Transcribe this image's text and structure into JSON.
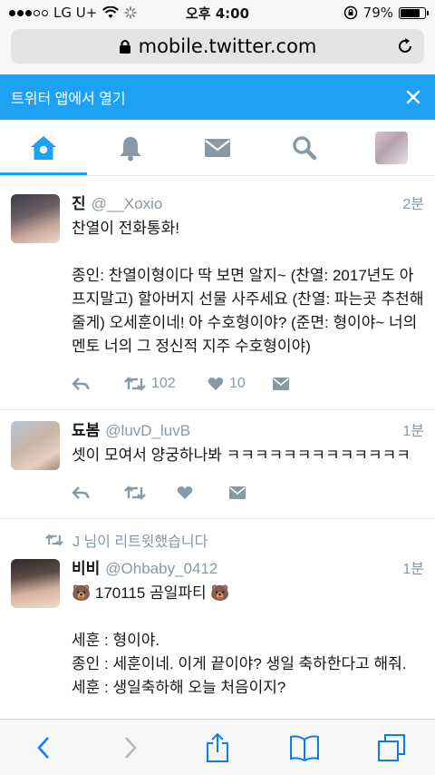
{
  "status_bar": {
    "carrier": "LG U+",
    "time": "오후 4:00",
    "battery_percent": "79%",
    "battery_level": 0.79,
    "signal_bars_filled": 3
  },
  "browser": {
    "url": "mobile.twitter.com"
  },
  "banner": {
    "text": "트위터 앱에서 열기"
  },
  "nav": {
    "items": [
      {
        "icon": "home-icon",
        "active": true
      },
      {
        "icon": "notifications-bell-icon",
        "active": false
      },
      {
        "icon": "messages-envelope-icon",
        "active": false
      },
      {
        "icon": "search-icon",
        "active": false
      },
      {
        "icon": "profile-avatar",
        "active": false
      }
    ]
  },
  "timeline": {
    "tweets": [
      {
        "name": "진",
        "handle": "@__Xoxio",
        "time": "2분",
        "text": "찬열이 전화통화!\n\n종인: 찬열이형이다 딱 보면 알지~ (찬열: 2017년도 아프지말고) 할아버지 선물 사주세요 (찬열: 파는곳 추천해줄게) 오세훈이네! 아 수호형이야? (준면: 형이야~ 너의 멘토 너의 그 정신적 지주 수호형이야)",
        "retweets": "102",
        "likes": "10"
      },
      {
        "name": "됴봄",
        "handle": "@luvD_luvB",
        "time": "1분",
        "text": "셋이 모여서 양궁하나봐 ㅋㅋㅋㅋㅋㅋㅋㅋㅋㅋㅋㅋㅋ",
        "retweets": "",
        "likes": ""
      },
      {
        "retweet_context": "J 님이 리트윗했습니다",
        "name": "비비",
        "handle": "@Ohbaby_0412",
        "time": "1분",
        "text": "🐻 170115 곰일파티 🐻\n\n세훈 : 형이야.\n종인 : 세훈이네. 이게 끝이야? 생일 축하한다고 해줘.\n세훈 : 생일축하해 오늘 처음이지?",
        "retweets": "",
        "likes": ""
      }
    ]
  },
  "colors": {
    "twitter_blue": "#1da1f2",
    "gray_text": "#8899a6",
    "safari_blue": "#0a7aff"
  }
}
